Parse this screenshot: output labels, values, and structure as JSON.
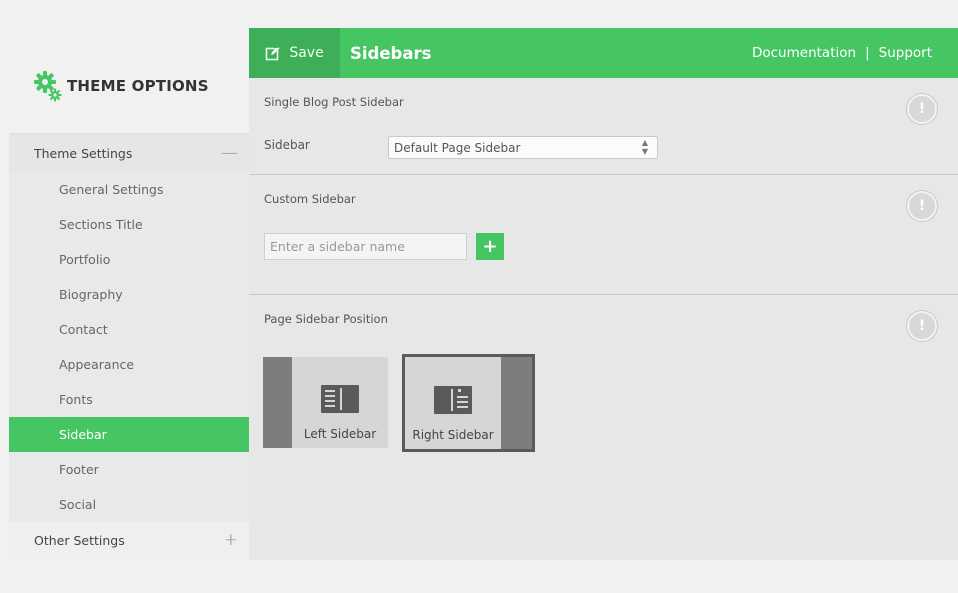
{
  "app": {
    "logo_title": "THEME OPTIONS",
    "accent_color": "#45c663"
  },
  "nav": {
    "section_theme_settings": "Theme Settings",
    "section_theme_settings_toggle": "—",
    "items": [
      {
        "label": "General Settings"
      },
      {
        "label": "Sections Title"
      },
      {
        "label": "Portfolio"
      },
      {
        "label": "Biography"
      },
      {
        "label": "Contact"
      },
      {
        "label": "Appearance"
      },
      {
        "label": "Fonts"
      },
      {
        "label": "Sidebar",
        "active": true
      },
      {
        "label": "Footer"
      },
      {
        "label": "Social"
      }
    ],
    "section_other_settings": "Other Settings",
    "section_other_settings_toggle": "+"
  },
  "header": {
    "save_label": "Save",
    "page_title": "Sidebars",
    "link_documentation": "Documentation",
    "link_separator": "|",
    "link_support": "Support"
  },
  "single_blog": {
    "title": "Single Blog Post Sidebar",
    "help_icon": "info-icon",
    "sidebar_label": "Sidebar",
    "sidebar_value": "Default Page Sidebar"
  },
  "custom_sidebar": {
    "title": "Custom Sidebar",
    "help_icon": "info-icon",
    "input_placeholder": "Enter a sidebar name",
    "add_label": "+"
  },
  "page_sidebar_position": {
    "title": "Page Sidebar Position",
    "help_icon": "info-icon",
    "options": [
      {
        "label": "Left Sidebar",
        "selected": false
      },
      {
        "label": "Right Sidebar",
        "selected": true
      }
    ]
  }
}
